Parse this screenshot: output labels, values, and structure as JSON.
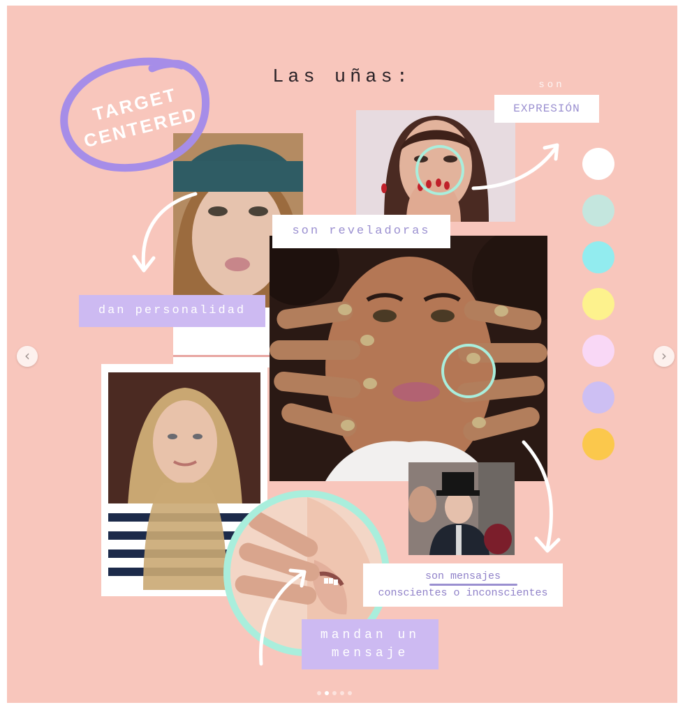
{
  "post": {
    "title": "Las uñas:",
    "badge": {
      "line1": "TARGET",
      "line2": "CENTERED",
      "ring_color": "#a68de8",
      "text_color": "#ffffff"
    },
    "labels": {
      "son": "son",
      "expresion": "EXPRESIÓN",
      "reveladoras": "son reveladoras",
      "personalidad": "dan personalidad",
      "mensajes_line1": "son mensajes",
      "mensajes_line2": "conscientes o inconscientes",
      "mandan_line1": "mandan un",
      "mandan_line2": "mensaje"
    },
    "palette": [
      "#ffffff",
      "#c4e6de",
      "#92ecef",
      "#fdf28d",
      "#f9d8f6",
      "#cdbff3",
      "#fbc84c"
    ],
    "colors": {
      "background": "#f8c6bc",
      "accent_lilac": "#cdbaf2",
      "accent_mint": "#a9eedc"
    },
    "photos": [
      {
        "subject": "woman-red-nails-hand-over-mouth"
      },
      {
        "subject": "woman-beanie-squinting"
      },
      {
        "subject": "woman-gold-glitter-nails-hands-on-face"
      },
      {
        "subject": "blonde-woman-striped-sweater"
      },
      {
        "subject": "woman-top-hat-suit"
      },
      {
        "subject": "whispering-mouth-hand"
      }
    ]
  },
  "navigation": {
    "prev_icon": "chevron-left-icon",
    "next_icon": "chevron-right-icon",
    "prev_glyph": "‹",
    "next_glyph": "›",
    "slide_count": 5,
    "active_slide": 2
  }
}
